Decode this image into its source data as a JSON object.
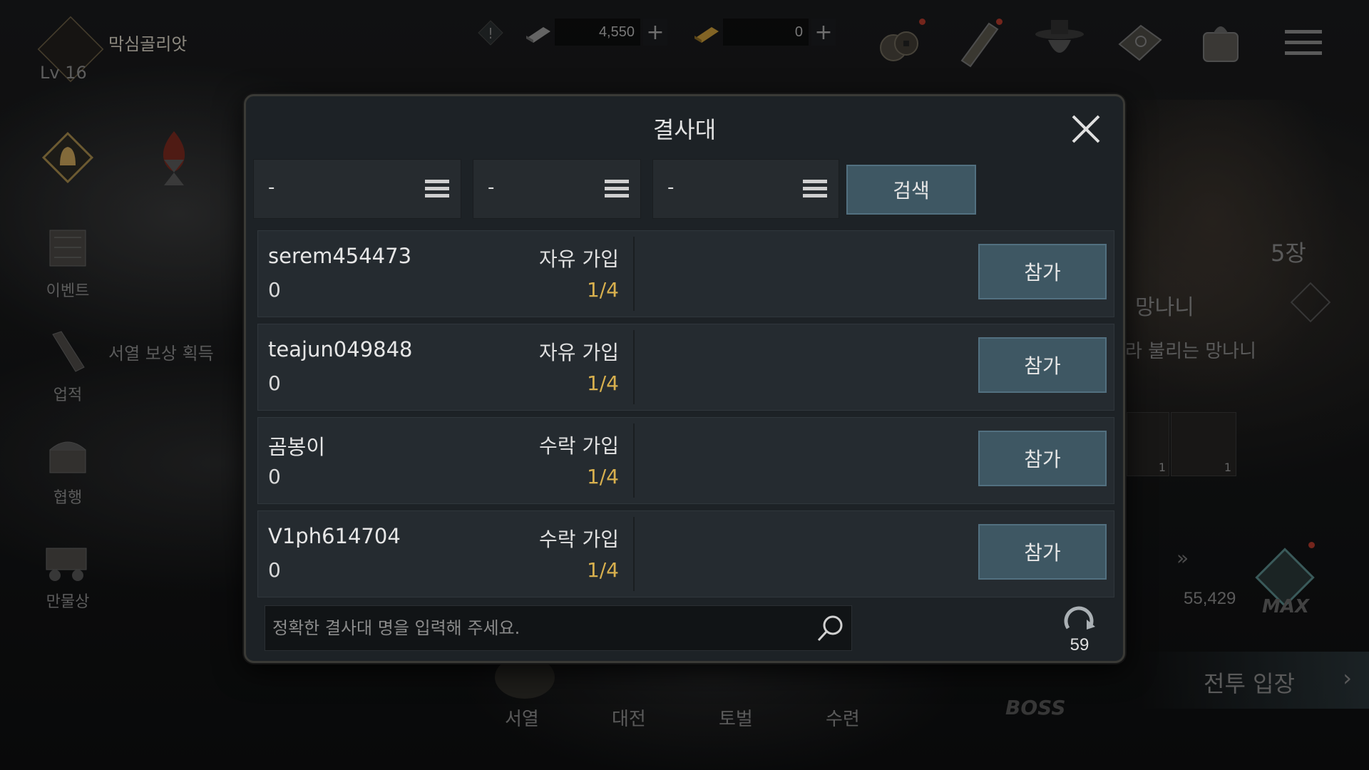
{
  "player": {
    "name": "막심골리앗",
    "level": "Lv 16"
  },
  "currency": {
    "silver": "4,550",
    "gold": "0"
  },
  "sidebar": {
    "event": "이벤트",
    "achievement": "업적",
    "chivalry": "협행",
    "shop": "만물상",
    "reward_text": "서열 보상 획득"
  },
  "bottom_nav": {
    "rank": "서열",
    "battle": "대전",
    "subjugation": "토벌",
    "training": "수련",
    "boss": "BOSS"
  },
  "right_panel": {
    "chapter": "5장",
    "char_name": "망나니",
    "desc": "라 불리는 망나니",
    "power": "55,429",
    "enter": "전투 입장",
    "max": "MAX",
    "item_count_1": "1",
    "item_count_2": "1"
  },
  "modal": {
    "title": "결사대",
    "filters": [
      "-",
      "-",
      "-"
    ],
    "search_label": "검색",
    "join_label": "참가",
    "rows": [
      {
        "name": "serem454473",
        "type": "자유 가입",
        "num": "0",
        "capacity": "1/4"
      },
      {
        "name": "teajun049848",
        "type": "자유 가입",
        "num": "0",
        "capacity": "1/4"
      },
      {
        "name": "곰봉이",
        "type": "수락 가입",
        "num": "0",
        "capacity": "1/4"
      },
      {
        "name": "V1ph614704",
        "type": "수락 가입",
        "num": "0",
        "capacity": "1/4"
      }
    ],
    "input_placeholder": "정확한 결사대 명을 입력해 주세요.",
    "refresh_count": "59"
  },
  "colors": {
    "accent_button": "#3e5763",
    "capacity": "#d8b04e",
    "notify_dot": "#b23a2c"
  }
}
